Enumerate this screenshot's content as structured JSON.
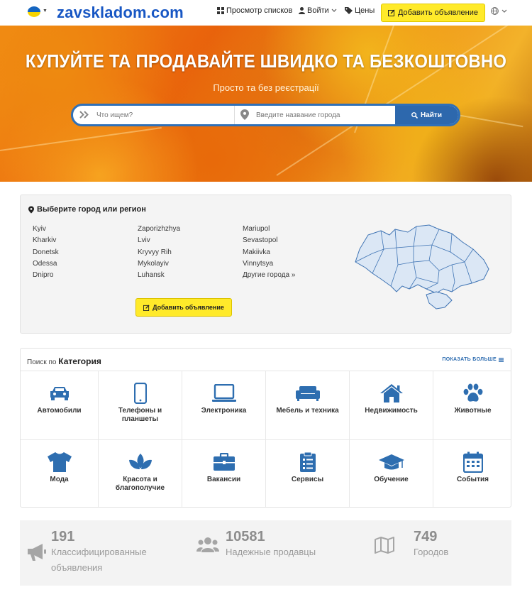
{
  "header": {
    "logo": "zavskladom.com",
    "nav_listings": "Просмотр списков",
    "nav_login": "Войти",
    "nav_prices": "Цены",
    "add_button": "Добавить объявление",
    "icons": [
      "ukraine-flag-icon",
      "grid-icon",
      "user-icon",
      "tag-icon",
      "edit-icon",
      "globe-icon",
      "chevron-down-icon"
    ]
  },
  "hero": {
    "title": "КУПУЙТЕ ТА ПРОДАВАЙТЕ ШВИДКО ТА БЕЗКОШТОВНО",
    "subtitle": "Просто та без реєстрації",
    "search_what_placeholder": "Что ищем?",
    "search_where_placeholder": "Введите название города",
    "search_button": "Найти"
  },
  "cities": {
    "title": "Выберите город или регион",
    "items": [
      "Kyiv",
      "Kharkiv",
      "Donetsk",
      "Odessa",
      "Dnipro",
      "Zaporizhzhya",
      "Lviv",
      "Kryvyy Rih",
      "Mykolayiv",
      "Luhansk",
      "Mariupol",
      "Sevastopol",
      "Makiivka",
      "Vinnytsya",
      "Другие города »"
    ],
    "add_button": "Добавить объявление"
  },
  "categories": {
    "prefix": "Поиск по",
    "title": "Категория",
    "show_more": "ПОКАЗАТЬ БОЛЬШЕ",
    "items": [
      {
        "label": "Автомобили",
        "icon": "car-icon"
      },
      {
        "label": "Телефоны и планшеты",
        "icon": "phone-icon"
      },
      {
        "label": "Электроника",
        "icon": "laptop-icon"
      },
      {
        "label": "Мебель и техника",
        "icon": "sofa-icon"
      },
      {
        "label": "Недвижимость",
        "icon": "house-icon"
      },
      {
        "label": "Животные",
        "icon": "paw-icon"
      },
      {
        "label": "Мода",
        "icon": "tshirt-icon"
      },
      {
        "label": "Красота и благополучие",
        "icon": "lotus-icon"
      },
      {
        "label": "Вакансии",
        "icon": "briefcase-icon"
      },
      {
        "label": "Сервисы",
        "icon": "clipboard-icon"
      },
      {
        "label": "Обучение",
        "icon": "graduation-cap-icon"
      },
      {
        "label": "События",
        "icon": "calendar-icon"
      }
    ],
    "accent_color": "#2e6eb0"
  },
  "stats": [
    {
      "value": "191",
      "label": "Классифицированные объявления",
      "icon": "bullhorn-icon"
    },
    {
      "value": "10581",
      "label": "Надежные продавцы",
      "icon": "users-icon"
    },
    {
      "value": "749",
      "label": "Городов",
      "icon": "map-icon"
    }
  ]
}
